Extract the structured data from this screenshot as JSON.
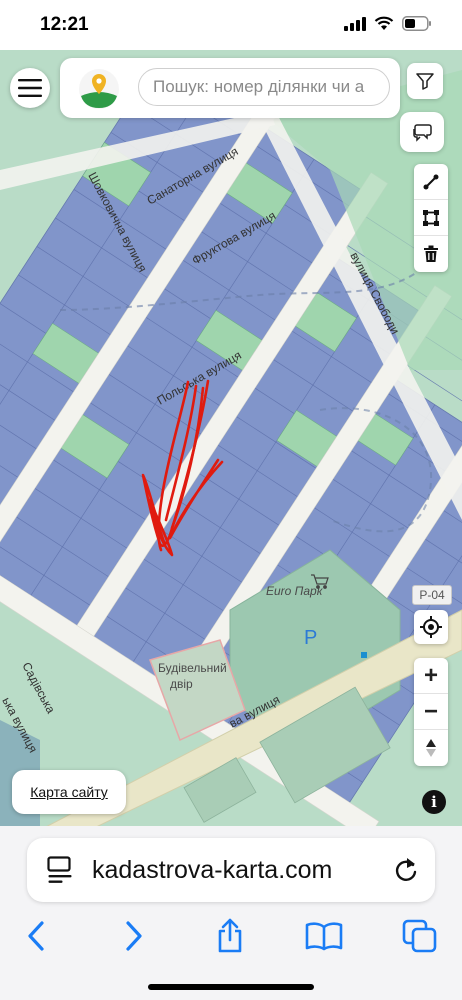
{
  "status_bar": {
    "time": "12:21"
  },
  "search": {
    "placeholder": "Пошук: номер ділянки чи а"
  },
  "map": {
    "streets": {
      "sanatorna": "Санаторна вулиця",
      "shovkovychna": "Шовковична вулиця",
      "fruktova": "Фруктова вулиця",
      "svobody": "вулиця Свободи",
      "polska": "Польська вулиця",
      "bottom": "ва вулиця",
      "sadova_left": "Садівська",
      "vertical_left": "ька вулиця"
    },
    "places": {
      "euro_park": "Euro Парк",
      "budivelnyi_dvir_line1": "Будівельний",
      "budivelnyi_dvir_line2": "двір",
      "parking": "P"
    },
    "route_badge": "P-04"
  },
  "controls": {
    "zoom_in": "+",
    "zoom_out": "−",
    "sitemap_link": "Карта сайту",
    "info": "i"
  },
  "browser": {
    "url": "kadastrova-karta.com"
  },
  "colors": {
    "parcel_blue": "#7b8fc9",
    "parcel_green": "#9fd3ae",
    "road": "#f2f2ee",
    "annotation": "#e01b0f"
  }
}
